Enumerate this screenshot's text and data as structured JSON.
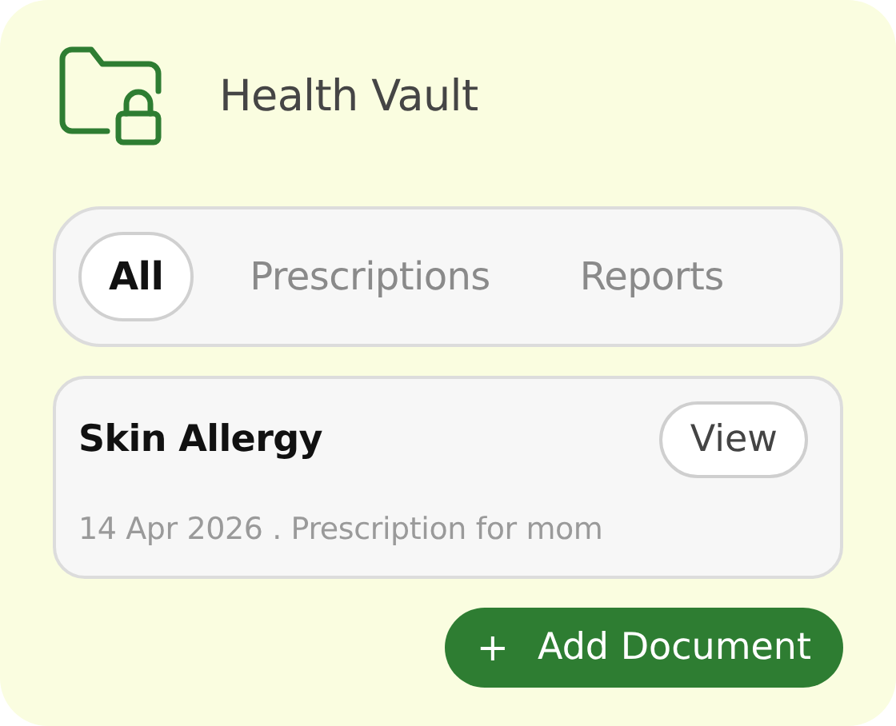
{
  "header": {
    "title": "Health Vault"
  },
  "tabs": [
    {
      "label": "All",
      "selected": true
    },
    {
      "label": "Prescriptions",
      "selected": false
    },
    {
      "label": "Reports",
      "selected": false
    }
  ],
  "documents": [
    {
      "title": "Skin Allergy",
      "action": "View",
      "meta": "14 Apr 2026 . Prescription for mom"
    }
  ],
  "add_button": {
    "icon": "+",
    "label": "Add Document"
  }
}
